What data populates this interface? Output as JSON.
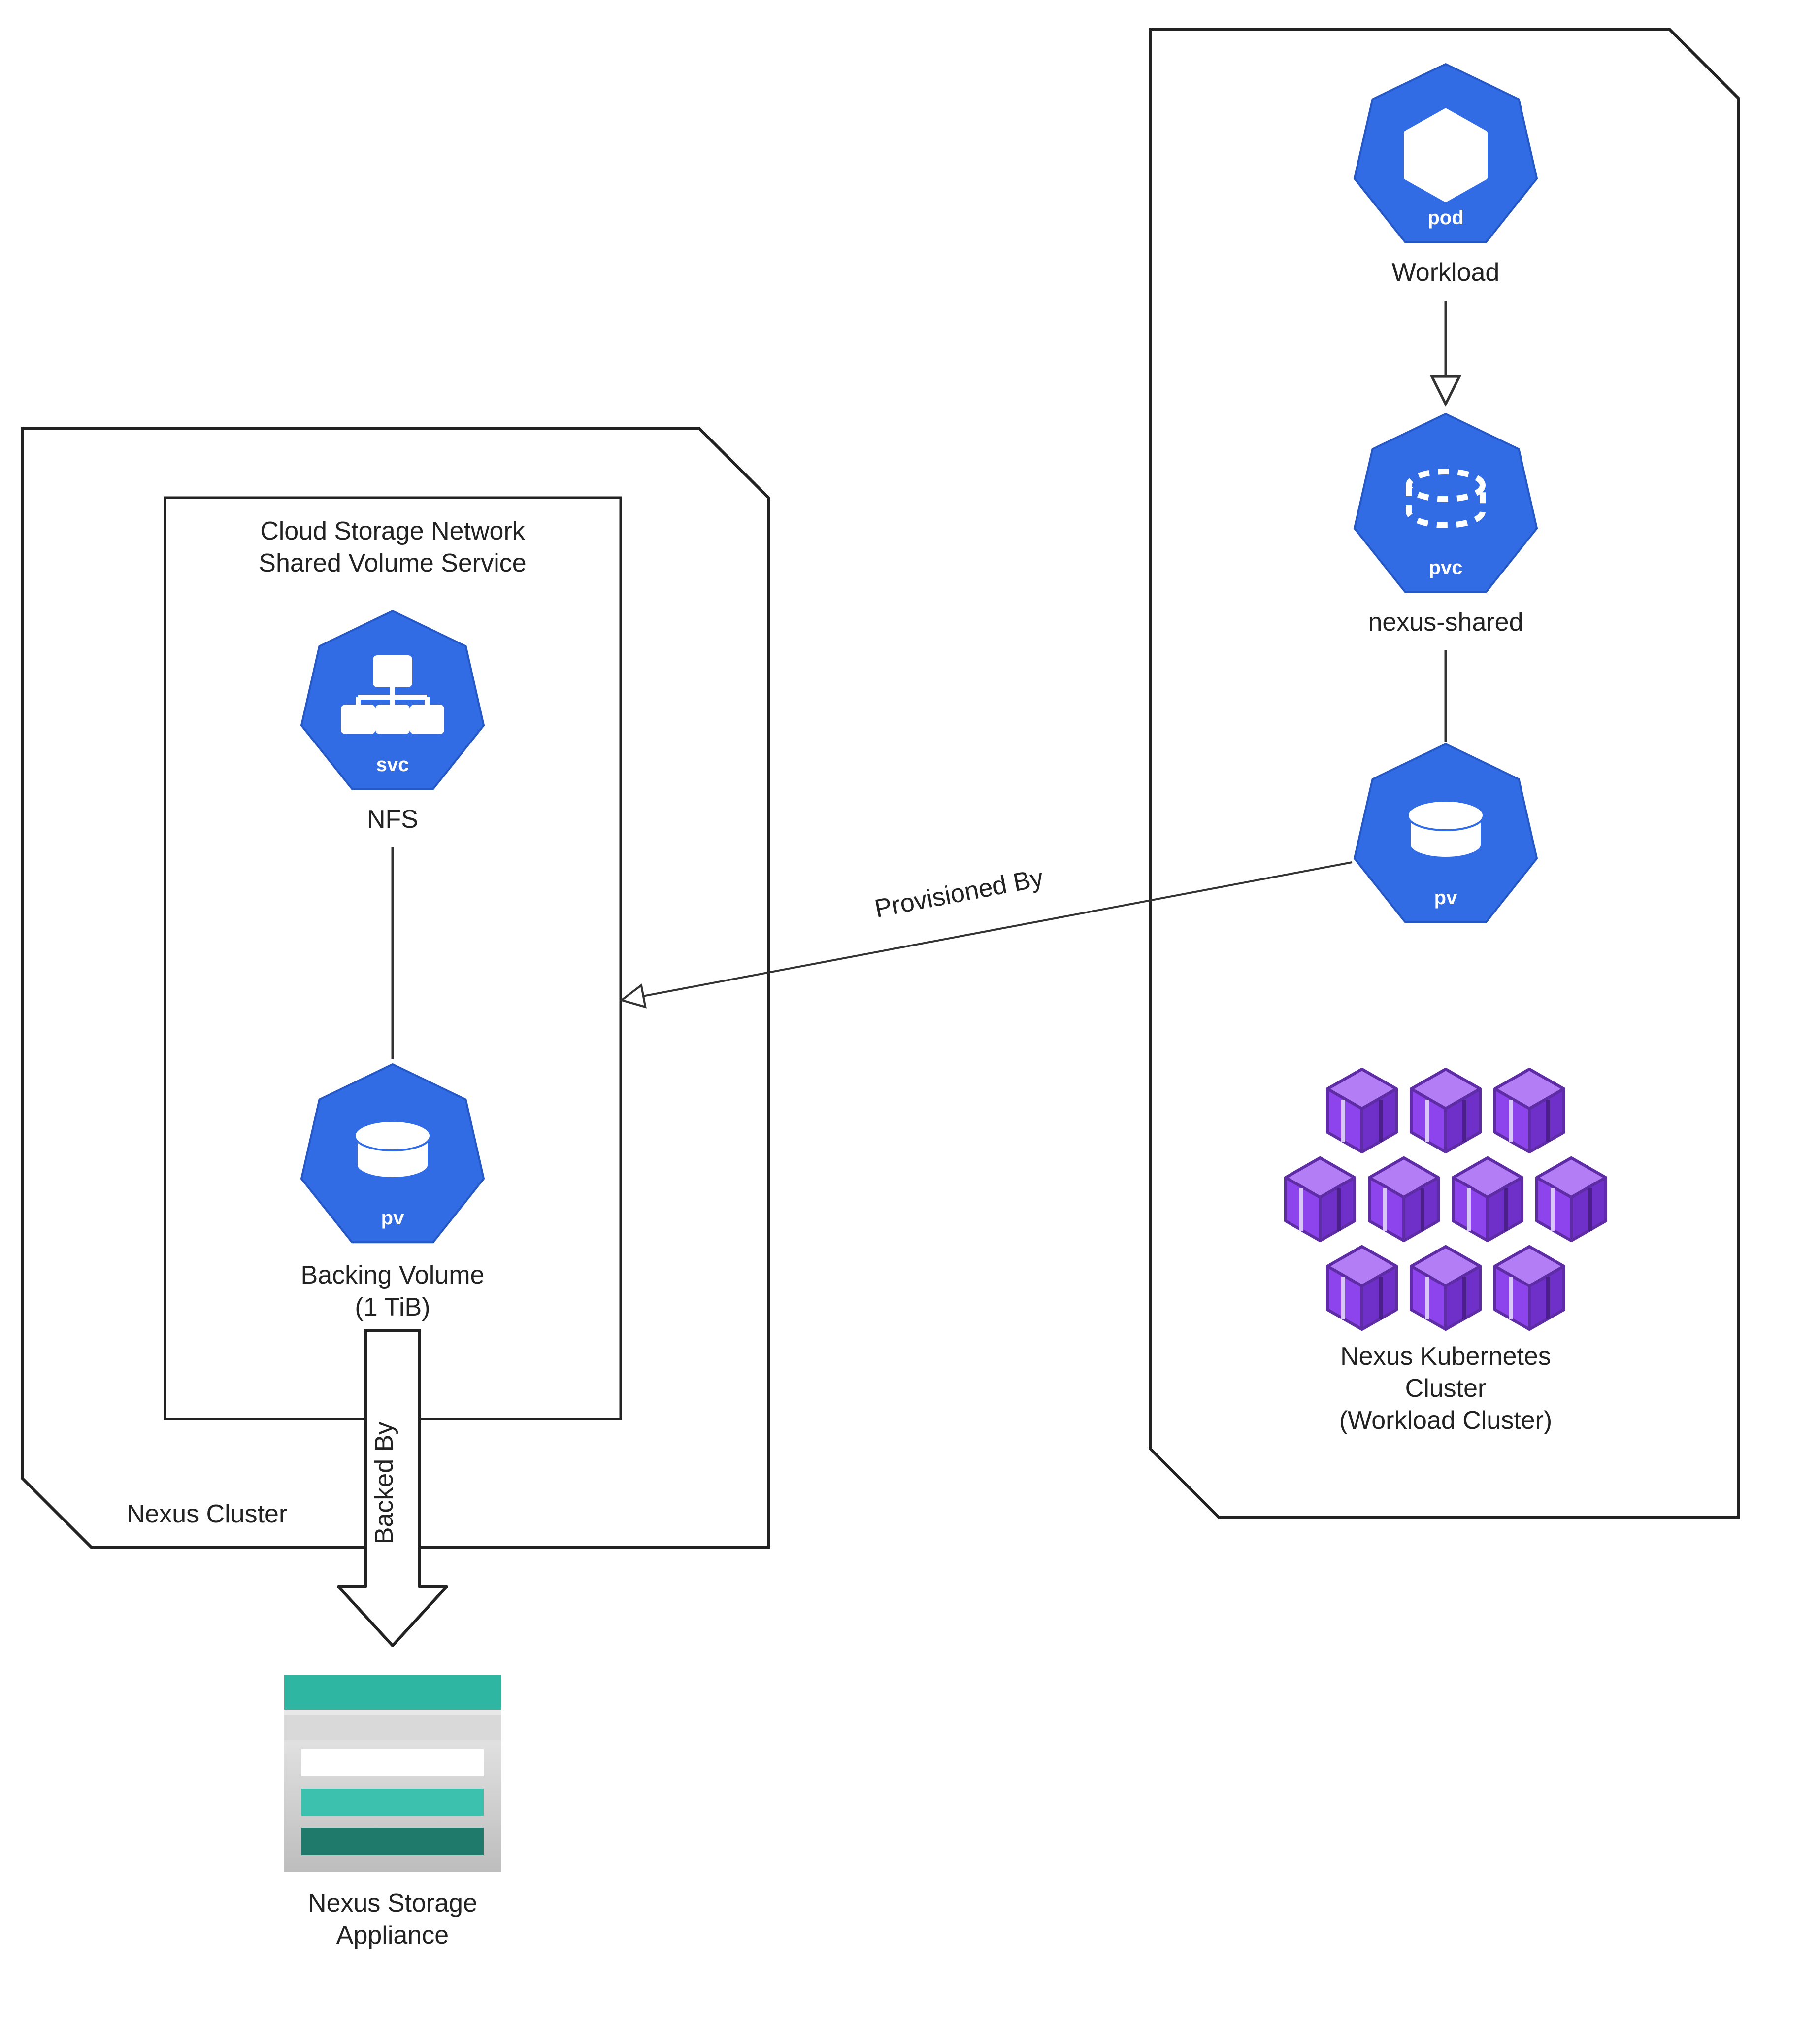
{
  "diagram": {
    "left_group": {
      "outer_label": "Nexus Cluster",
      "inner_title_line1": "Cloud Storage Network",
      "inner_title_line2": "Shared Volume Service",
      "svc": {
        "tag": "svc",
        "label": "NFS"
      },
      "pv": {
        "tag": "pv",
        "label_line1": "Backing Volume",
        "label_line2": "(1 TiB)"
      }
    },
    "right_group": {
      "pod": {
        "tag": "pod",
        "label": "Workload"
      },
      "pvc": {
        "tag": "pvc",
        "label": "nexus-shared"
      },
      "pv": {
        "tag": "pv"
      },
      "cluster_label_line1": "Nexus Kubernetes",
      "cluster_label_line2": "Cluster",
      "cluster_label_line3": "(Workload Cluster)"
    },
    "storage": {
      "label_line1": "Nexus Storage",
      "label_line2": "Appliance"
    },
    "edges": {
      "provisioned_by": "Provisioned By",
      "backed_by": "Backed By"
    }
  }
}
